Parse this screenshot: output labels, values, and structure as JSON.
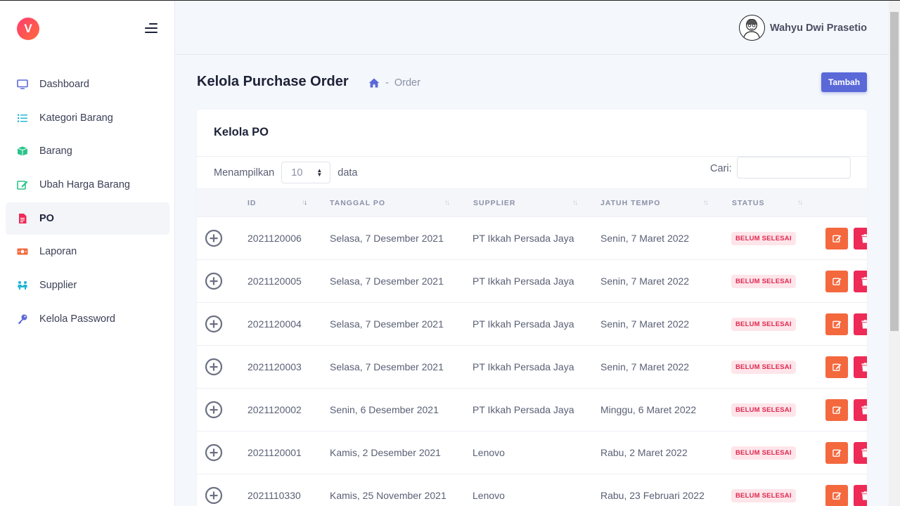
{
  "brand": {
    "logo_letter": "V",
    "accent": "#5a68d8"
  },
  "sidebar": {
    "items": [
      {
        "label": "Dashboard",
        "icon": "monitor-icon",
        "color": "#5a68d8",
        "active": false
      },
      {
        "label": "Kategori Barang",
        "icon": "list-icon",
        "color": "#1cb5d6",
        "active": false
      },
      {
        "label": "Barang",
        "icon": "box-icon",
        "color": "#2bc48a",
        "active": false
      },
      {
        "label": "Ubah Harga Barang",
        "icon": "edit-icon",
        "color": "#2bc48a",
        "active": false
      },
      {
        "label": "PO",
        "icon": "file-icon",
        "color": "#ee2a56",
        "active": true
      },
      {
        "label": "Laporan",
        "icon": "money-icon",
        "color": "#f4683e",
        "active": false
      },
      {
        "label": "Supplier",
        "icon": "people-icon",
        "color": "#1cb5d6",
        "active": false
      },
      {
        "label": "Kelola Password",
        "icon": "key-icon",
        "color": "#5a68d8",
        "active": false
      }
    ]
  },
  "header": {
    "username": "Wahyu Dwi Prasetio"
  },
  "page": {
    "title": "Kelola Purchase Order",
    "breadcrumb_sep": "-",
    "breadcrumb_current": "Order",
    "add_button": "Tambah"
  },
  "card": {
    "title": "Kelola PO",
    "length_label_pre": "Menampilkan",
    "length_value": "10",
    "length_label_post": "data",
    "search_label": "Cari:",
    "search_value": ""
  },
  "table": {
    "columns": [
      "ID",
      "TANGGAL PO",
      "SUPPLIER",
      "JATUH TEMPO",
      "STATUS"
    ],
    "rows": [
      {
        "id": "2021120006",
        "tanggal": "Selasa, 7 Desember 2021",
        "supplier": "PT Ikkah Persada Jaya",
        "jatuh_tempo": "Senin, 7 Maret 2022",
        "status": "BELUM SELESAI"
      },
      {
        "id": "2021120005",
        "tanggal": "Selasa, 7 Desember 2021",
        "supplier": "PT Ikkah Persada Jaya",
        "jatuh_tempo": "Senin, 7 Maret 2022",
        "status": "BELUM SELESAI"
      },
      {
        "id": "2021120004",
        "tanggal": "Selasa, 7 Desember 2021",
        "supplier": "PT Ikkah Persada Jaya",
        "jatuh_tempo": "Senin, 7 Maret 2022",
        "status": "BELUM SELESAI"
      },
      {
        "id": "2021120003",
        "tanggal": "Selasa, 7 Desember 2021",
        "supplier": "PT Ikkah Persada Jaya",
        "jatuh_tempo": "Senin, 7 Maret 2022",
        "status": "BELUM SELESAI"
      },
      {
        "id": "2021120002",
        "tanggal": "Senin, 6 Desember 2021",
        "supplier": "PT Ikkah Persada Jaya",
        "jatuh_tempo": "Minggu, 6 Maret 2022",
        "status": "BELUM SELESAI"
      },
      {
        "id": "2021120001",
        "tanggal": "Kamis, 2 Desember 2021",
        "supplier": "Lenovo",
        "jatuh_tempo": "Rabu, 2 Maret 2022",
        "status": "BELUM SELESAI"
      },
      {
        "id": "2021110330",
        "tanggal": "Kamis, 25 November 2021",
        "supplier": "Lenovo",
        "jatuh_tempo": "Rabu, 23 Februari 2022",
        "status": "BELUM SELESAI"
      }
    ]
  },
  "colors": {
    "edit_button": "#f4683e",
    "delete_button": "#ee2a56",
    "status_badge_bg": "#fde5ea",
    "status_badge_text": "#e0284f"
  }
}
